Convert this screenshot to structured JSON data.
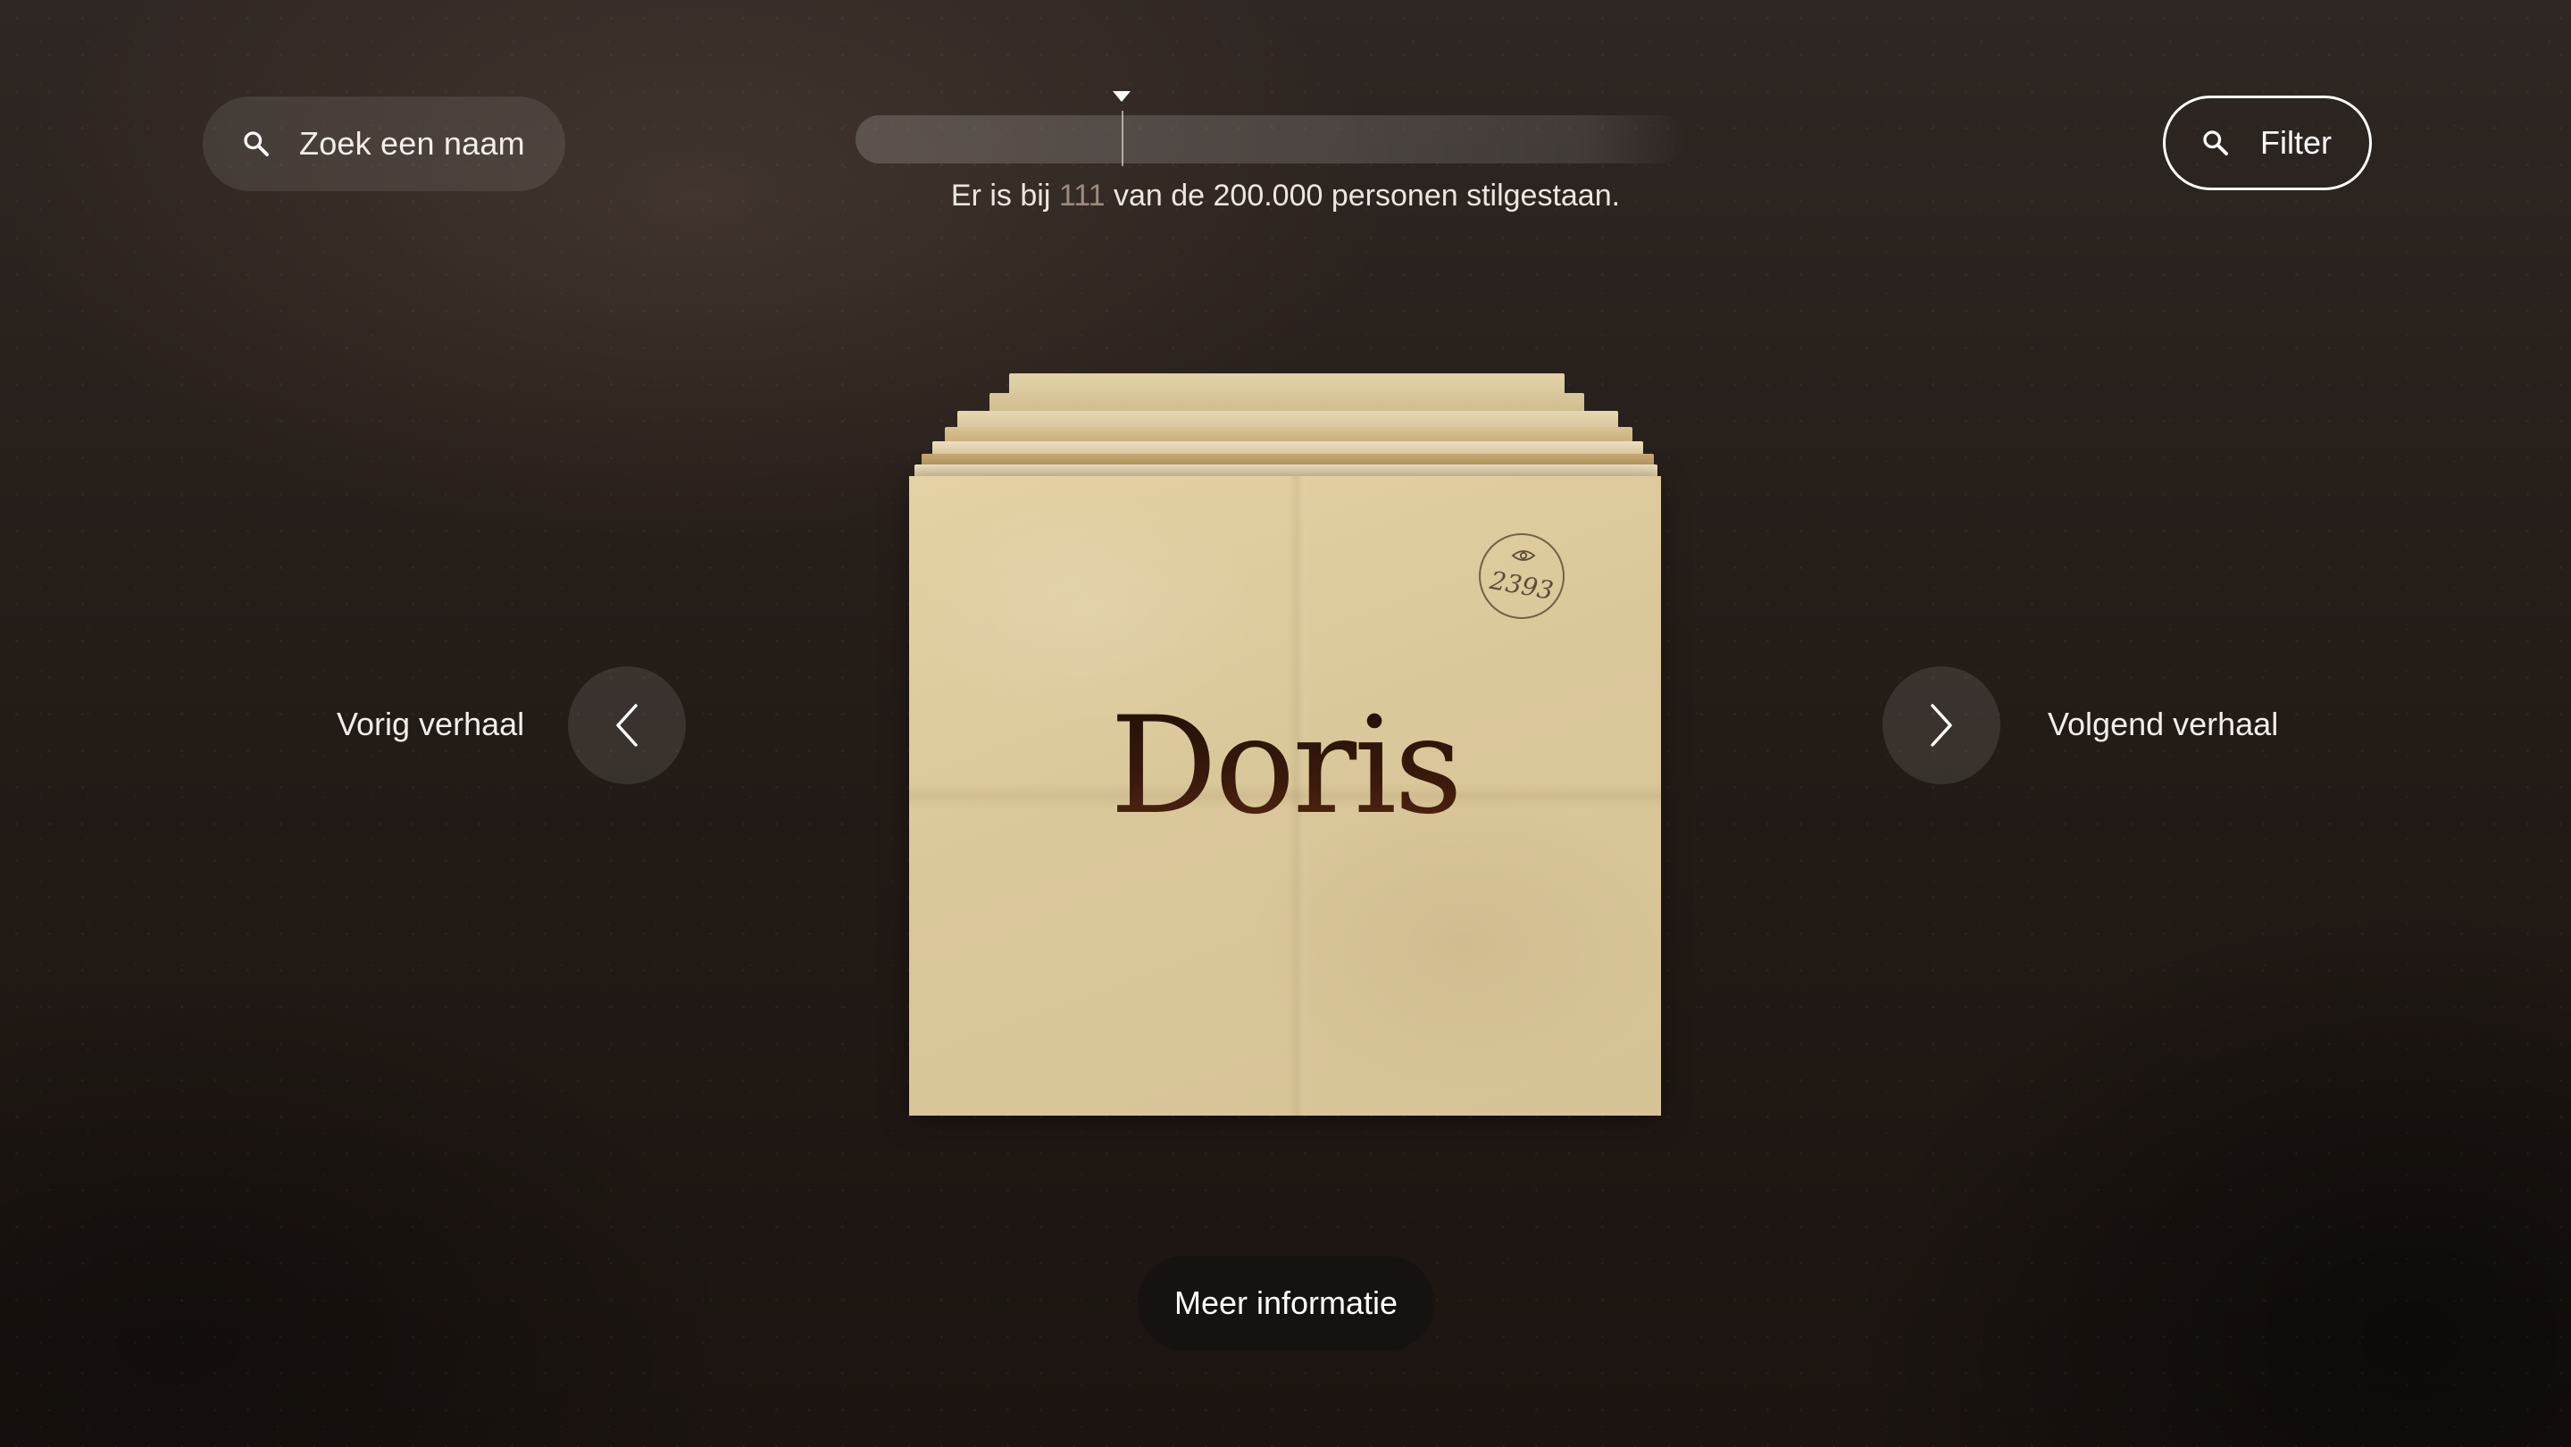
{
  "search": {
    "label": "Zoek een naam",
    "icon": "search-icon"
  },
  "progress": {
    "text_before": "Er is bij ",
    "count": "111",
    "text_after": " van de 200.000 personen stilgestaan.",
    "accent_color": "#9c8a7c"
  },
  "filter": {
    "label": "Filter",
    "icon": "search-icon"
  },
  "navigation": {
    "prev_label": "Vorig verhaal",
    "prev_icon": "chevron-left-icon",
    "next_label": "Volgend verhaal",
    "next_icon": "chevron-right-icon"
  },
  "card": {
    "name": "Doris",
    "stamp_number": "2393",
    "stamp_icon": "eye-icon",
    "paper_color": "#dac79a",
    "name_color": "#2a130a"
  },
  "more_info": {
    "label": "Meer informatie"
  }
}
